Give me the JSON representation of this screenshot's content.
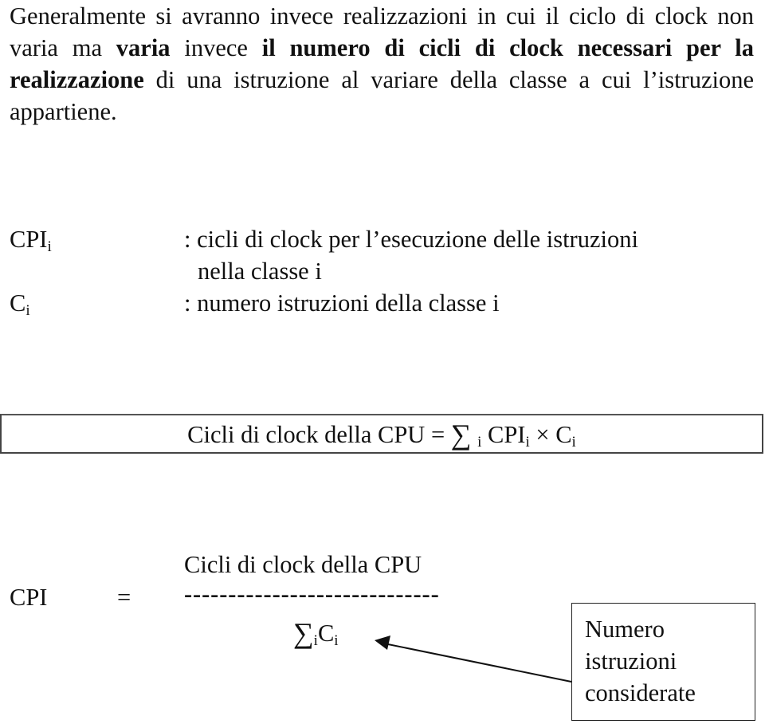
{
  "paragraph": {
    "segments": [
      {
        "text": "Generalmente si avranno invece realizzazioni in cui il ciclo di clock non varia ma ",
        "bold": false
      },
      {
        "text": "varia",
        "bold": true
      },
      {
        "text": " invece ",
        "bold": false
      },
      {
        "text": "il numero di cicli di clock necessari per la realizzazione",
        "bold": true
      },
      {
        "text": " di una istruzione al variare della classe a cui l’istruzione appartiene.",
        "bold": false
      }
    ]
  },
  "definitions": [
    {
      "symbol": "CPI",
      "subscript": "i",
      "description_line1": ": cicli di clock per l’esecuzione delle istruzioni",
      "description_line2": "nella classe i"
    },
    {
      "symbol": "C",
      "subscript": "i",
      "description_line1": ": numero istruzioni della classe i"
    }
  ],
  "formula_box": {
    "lhs": "Cicli di clock della CPU =",
    "sigma": "∑",
    "sum_index": "i",
    "term1": "CPI",
    "term1_sub": "i",
    "times": "×",
    "term2": "C",
    "term2_sub": "i"
  },
  "cpi_formula": {
    "lhs": "CPI",
    "equals": "=",
    "numerator": "Cicli di clock della CPU",
    "fraction_bar": "-----------------------------",
    "denominator_sigma": "∑",
    "denominator_index": "i",
    "denominator_term": "C",
    "denominator_sub": "i"
  },
  "annotation": {
    "lines": [
      "Numero",
      "istruzioni",
      "considerate"
    ]
  }
}
